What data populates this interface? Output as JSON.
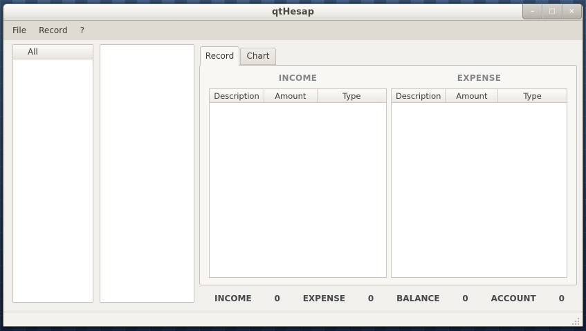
{
  "window": {
    "title": "qtHesap",
    "controls": {
      "minimize": "–",
      "maximize": "□",
      "close": "×"
    }
  },
  "menubar": {
    "items": [
      "File",
      "Record",
      "?"
    ]
  },
  "sidebar": {
    "tree_header": "All"
  },
  "tabs": [
    {
      "label": "Record",
      "active": true
    },
    {
      "label": "Chart",
      "active": false
    }
  ],
  "record_view": {
    "income": {
      "caption": "INCOME",
      "columns": [
        "Description",
        "Amount",
        "Type"
      ],
      "rows": []
    },
    "expense": {
      "caption": "EXPENSE",
      "columns": [
        "Description",
        "Amount",
        "Type"
      ],
      "rows": []
    },
    "totals": [
      {
        "label": "INCOME",
        "value": "0"
      },
      {
        "label": "EXPENSE",
        "value": "0"
      },
      {
        "label": "BALANCE",
        "value": "0"
      },
      {
        "label": "ACCOUNT",
        "value": "0"
      }
    ]
  },
  "colors": {
    "desktop_blue": "#2f4769",
    "menubar_bg": "#dfdbd2",
    "caption_gray": "#85868b",
    "window_bg": "#f1f0ed"
  }
}
